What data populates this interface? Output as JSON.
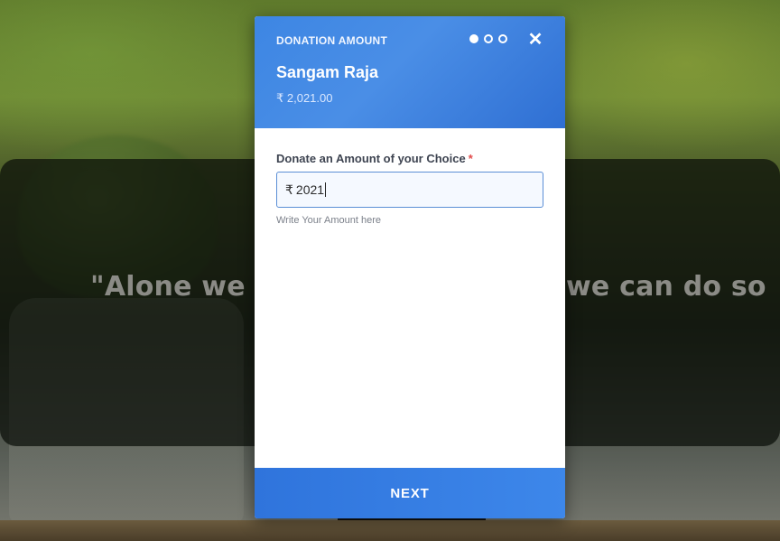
{
  "background": {
    "quote_left": "\"Alone we ca",
    "quote_right": "we can do so"
  },
  "modal": {
    "header": {
      "title": "DONATION AMOUNT",
      "steps_total": 3,
      "steps_current": 1,
      "recipient_name": "Sangam Raja",
      "recipient_amount": "₹ 2,021.00"
    },
    "form": {
      "label": "Donate an Amount of your Choice",
      "required_mark": "*",
      "currency_symbol": "₹",
      "amount_value": "2021",
      "help_text": "Write Your Amount here"
    },
    "next_label": "NEXT",
    "close_icon": "close-icon"
  },
  "colors": {
    "accent": "#3d86e3",
    "required": "#e24b4b"
  }
}
